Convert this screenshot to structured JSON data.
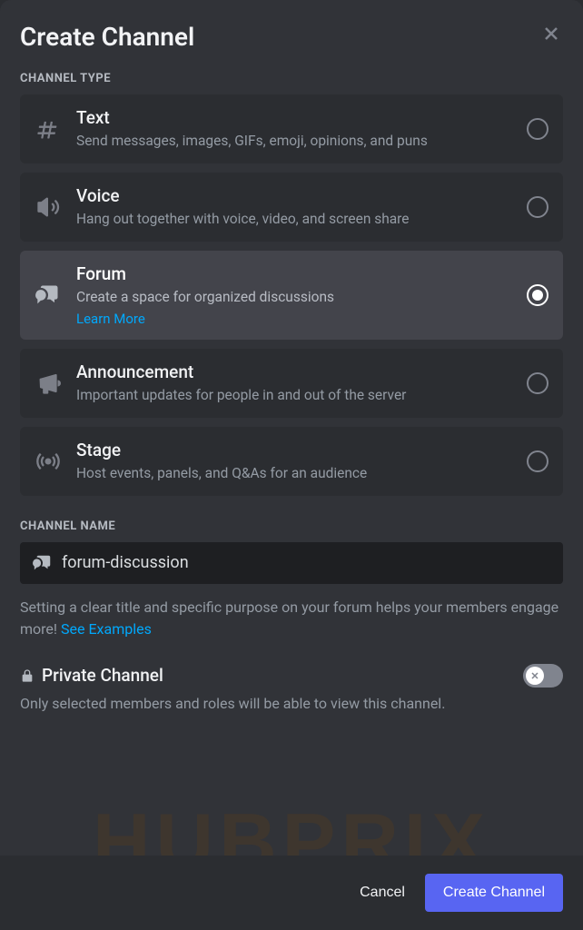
{
  "modal": {
    "title": "Create Channel"
  },
  "sections": {
    "type_label": "CHANNEL TYPE",
    "name_label": "CHANNEL NAME"
  },
  "types": [
    {
      "title": "Text",
      "desc": "Send messages, images, GIFs, emoji, opinions, and puns"
    },
    {
      "title": "Voice",
      "desc": "Hang out together with voice, video, and screen share"
    },
    {
      "title": "Forum",
      "desc": "Create a space for organized discussions",
      "learn_more": "Learn More"
    },
    {
      "title": "Announcement",
      "desc": "Important updates for people in and out of the server"
    },
    {
      "title": "Stage",
      "desc": "Host events, panels, and Q&As for an audience"
    }
  ],
  "name_input": {
    "value": "forum-discussion"
  },
  "helper": {
    "text": "Setting a clear title and specific purpose on your forum helps your members engage more! ",
    "link": "See Examples"
  },
  "private": {
    "label": "Private Channel",
    "desc": "Only selected members and roles will be able to view this channel."
  },
  "footer": {
    "cancel": "Cancel",
    "create": "Create Channel"
  },
  "watermark": "HUBPRIX"
}
